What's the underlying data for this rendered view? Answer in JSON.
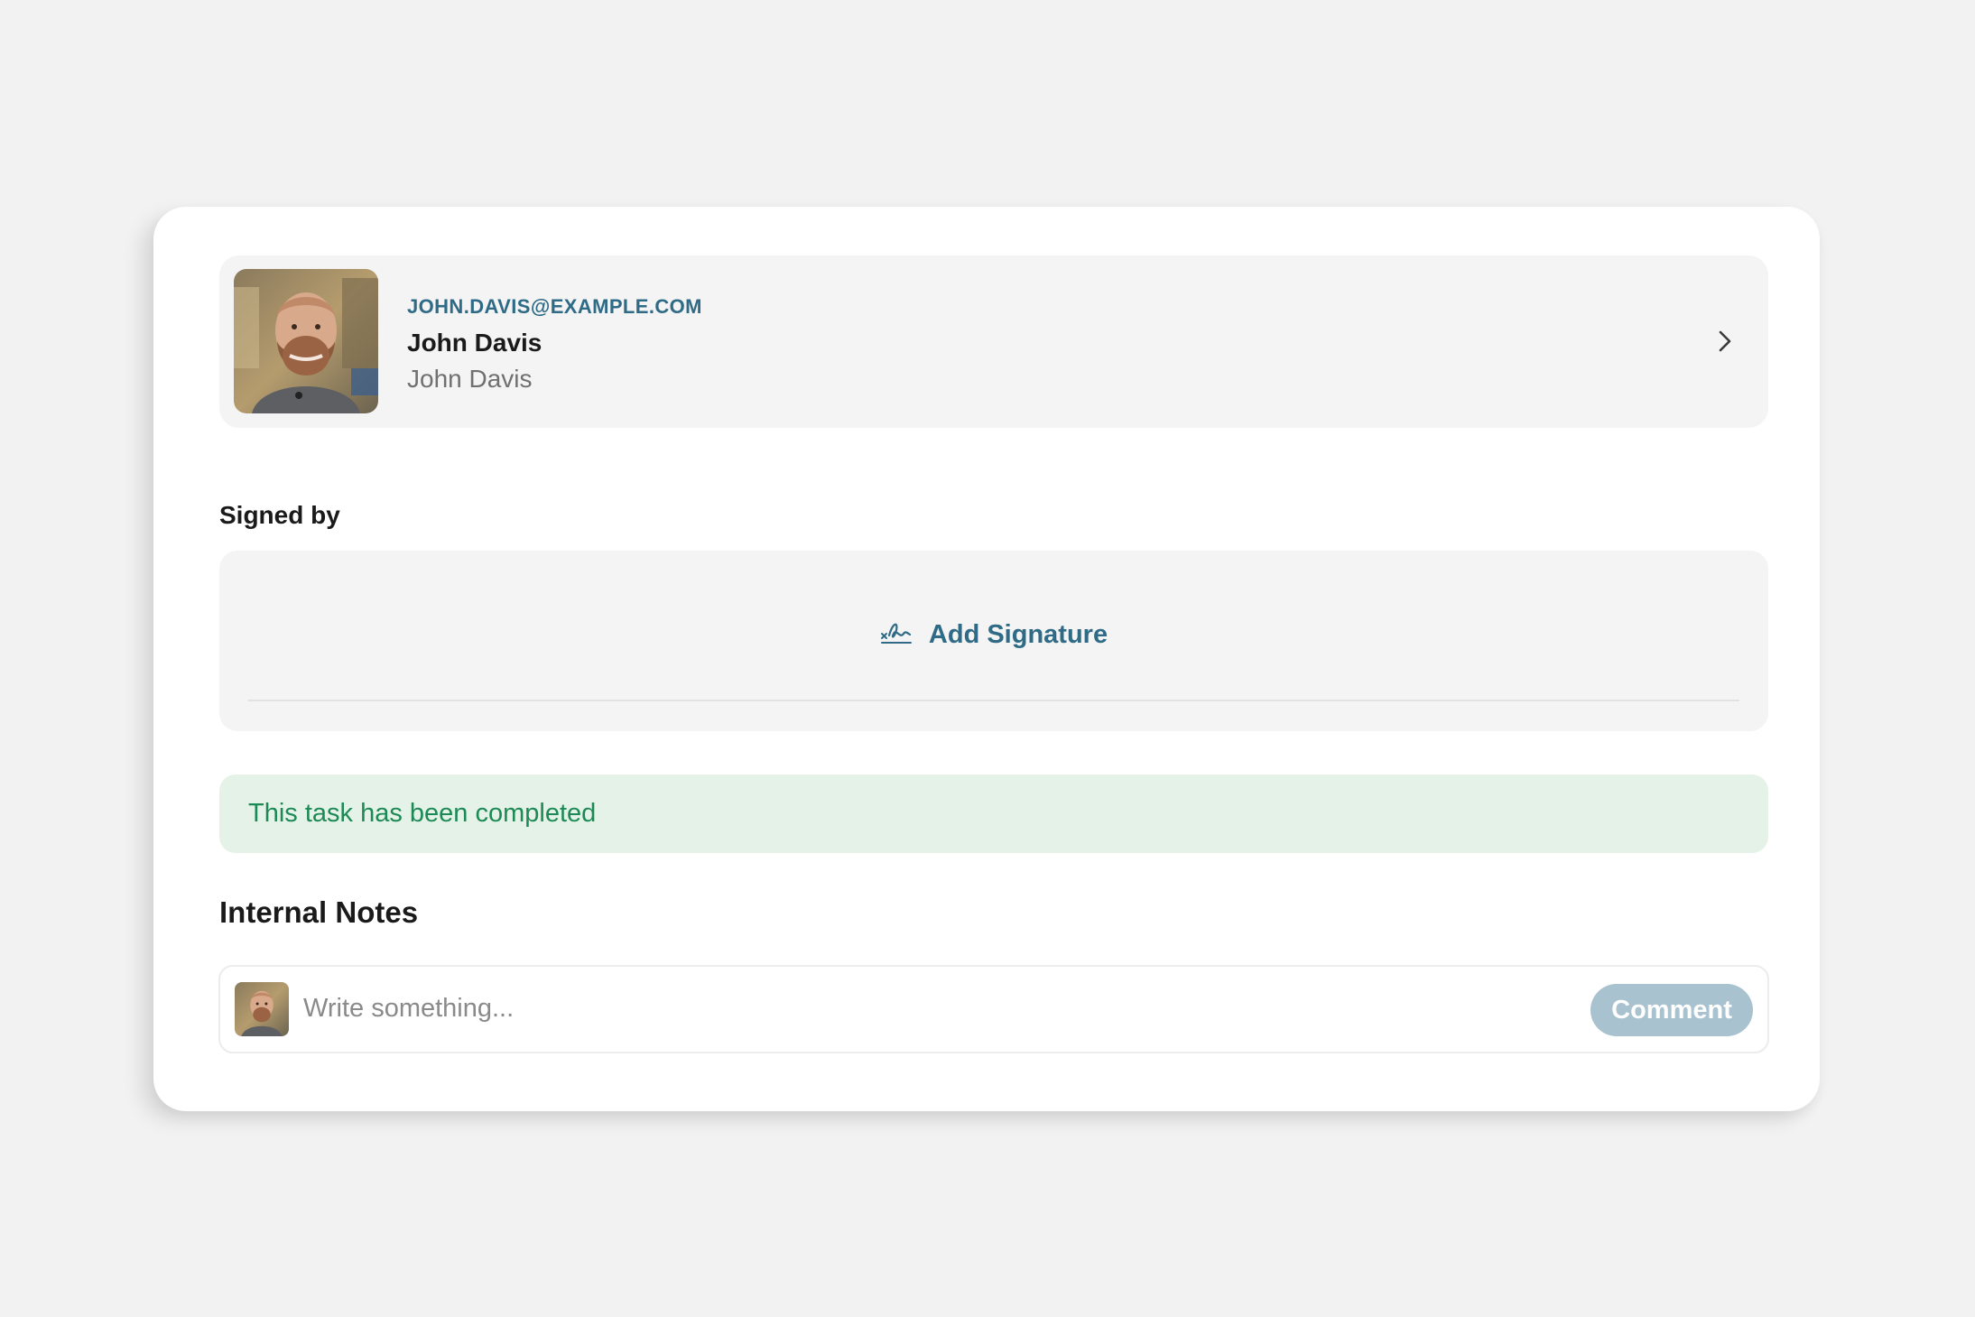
{
  "user": {
    "email": "JOHN.DAVIS@EXAMPLE.COM",
    "name": "John Davis",
    "subtitle": "John Davis"
  },
  "signature": {
    "section_label": "Signed by",
    "button_label": "Add Signature"
  },
  "status": {
    "message": "This task has been completed"
  },
  "notes": {
    "title": "Internal Notes",
    "placeholder": "Write something...",
    "submit_label": "Comment"
  },
  "colors": {
    "accent": "#2f6b86",
    "success_text": "#1d8a55",
    "success_bg": "#e4f2e8",
    "button_disabled": "#a9c2cf"
  },
  "icons": {
    "user_row": "chevron-right-icon",
    "signature": "signature-icon"
  }
}
